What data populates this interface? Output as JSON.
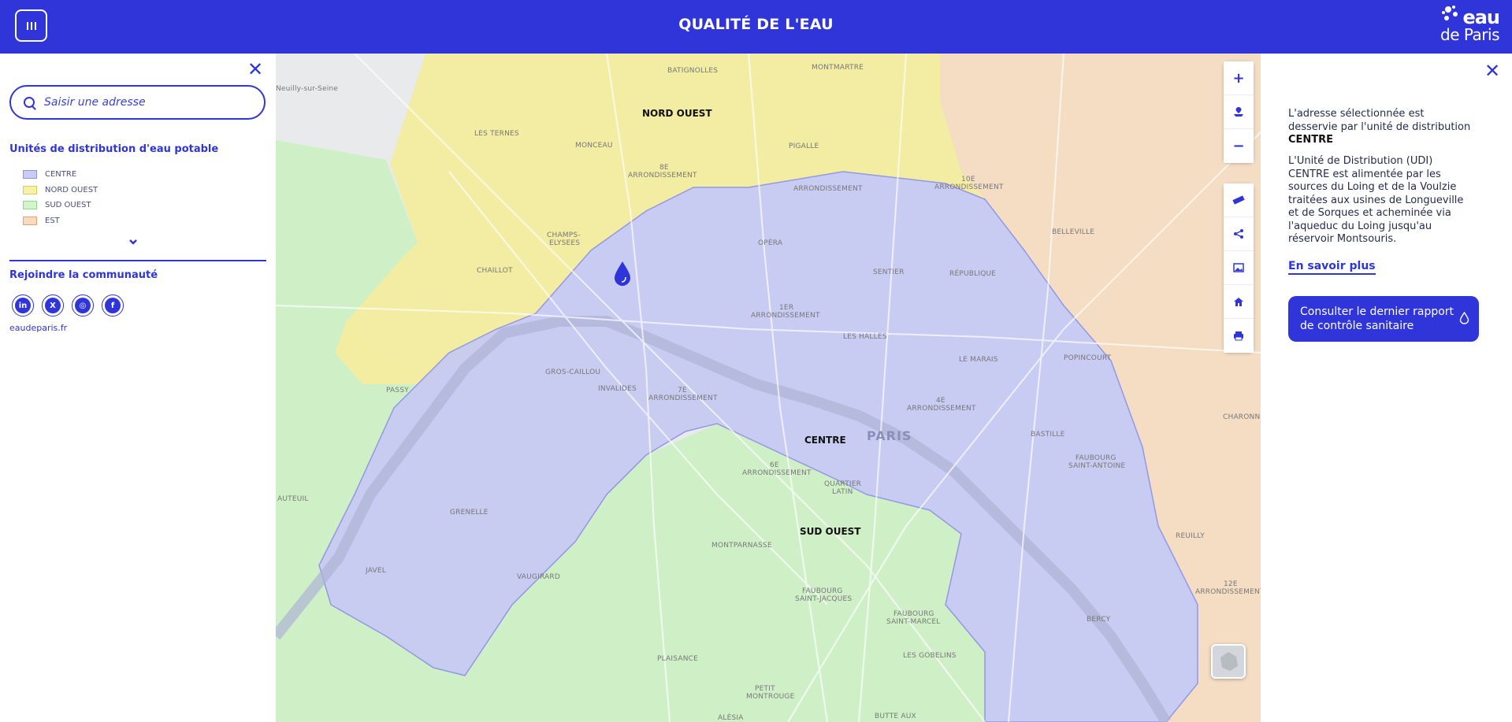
{
  "header": {
    "title": "QUALITÉ DE L'EAU",
    "brand_line1": "eau",
    "brand_line2": "de Paris"
  },
  "left_panel": {
    "search_placeholder": "Saisir une adresse",
    "legend_title": "Unités de distribution d'eau potable",
    "legend": [
      {
        "label": "CENTRE",
        "color": "#c9ccf5",
        "border": "#8d93e0"
      },
      {
        "label": "NORD OUEST",
        "color": "#f6f1a8",
        "border": "#d8cf5a"
      },
      {
        "label": "SUD OUEST",
        "color": "#d2f5cb",
        "border": "#98d58c"
      },
      {
        "label": "EST",
        "color": "#fbd9bd",
        "border": "#e6a46c"
      }
    ],
    "community_title": "Rejoindre la communauté",
    "socials": [
      {
        "name": "linkedin",
        "glyph": "in"
      },
      {
        "name": "x",
        "glyph": "X"
      },
      {
        "name": "instagram",
        "glyph": "◎"
      },
      {
        "name": "facebook",
        "glyph": "f"
      }
    ],
    "site_link": "eaudeparis.fr"
  },
  "map": {
    "zones": [
      {
        "name": "NORD OUEST",
        "color": "#f3ec9f"
      },
      {
        "name": "CENTRE",
        "color": "#c8cbf3"
      },
      {
        "name": "SUD OUEST",
        "color": "#cdf0c5"
      },
      {
        "name": "EST",
        "color": "#f6dcc2"
      }
    ],
    "zone_labels": {
      "nord_ouest": "NORD OUEST",
      "centre": "CENTRE",
      "sud_ouest": "SUD OUEST"
    },
    "city_label": "PARIS",
    "places": {
      "neuilly": "Neuilly-sur-Seine",
      "batignolles": "BATIGNOLLES",
      "montmartre": "MONTMARTRE",
      "les_ternes": "LES TERNES",
      "monceau": "MONCEAU",
      "pigalle": "PIGALLE",
      "arr8_a": "8E",
      "arr8_b": "ARRONDISSEMENT",
      "arr9": "ARRONDISSEMENT",
      "arr10_a": "10E",
      "arr10_b": "ARRONDISSEMENT",
      "champs": "CHAMPS-",
      "elysees": "ELYSEES",
      "opera": "OPÉRA",
      "chaillot": "CHAILLOT",
      "belleville": "BELLEVILLE",
      "sentier": "SENTIER",
      "republique": "RÉPUBLIQUE",
      "arr1_a": "1ER",
      "arr1_b": "ARRONDISSEMENT",
      "les_halles": "LES HALLES",
      "gros_caillou": "GROS-CAILLOU",
      "passy": "PASSY",
      "invalides": "INVALIDES",
      "arr7_a": "7E",
      "arr7_b": "ARRONDISSEMENT",
      "le_marais": "LE MARAIS",
      "popincourt": "POPINCOURT",
      "arr4_a": "4E",
      "arr4_b": "ARRONDISSEMENT",
      "bastille": "BASTILLE",
      "faubourg_sa_a": "FAUBOURG",
      "faubourg_sa_b": "SAINT-ANTOINE",
      "arr6_a": "6E",
      "arr6_b": "ARRONDISSEMENT",
      "quartier_a": "QUARTIER",
      "quartier_b": "LATIN",
      "auteuil": "AUTEUIL",
      "grenelle": "GRENELLE",
      "charonne": "CHARONNE",
      "montparnasse": "MONTPARNASSE",
      "reuilly": "REUILLY",
      "javel": "JAVEL",
      "vaugirard": "VAUGIRARD",
      "faubourg_sj_a": "FAUBOURG",
      "faubourg_sj_b": "SAINT-JACQUES",
      "faubourg_sm_a": "FAUBOURG",
      "faubourg_sm_b": "SAINT-MARCEL",
      "arr12_a": "12E",
      "arr12_b": "ARRONDISSEMENT",
      "bercy": "BERCY",
      "plaisance": "PLAISANCE",
      "les_gobelins": "LES GOBELINS",
      "petit_a": "PETIT",
      "petit_b": "MONTROUGE",
      "alesia": "ALÉSIA",
      "butte": "BUTTE AUX"
    }
  },
  "controls": {
    "zoom_in": "+",
    "zoom_out": "−"
  },
  "right_panel": {
    "intro": "L'adresse sélectionnée est desservie par l'unité de distribution",
    "udi_name": "CENTRE",
    "description": "L'Unité de Distribution (UDI) CENTRE est alimentée par les sources du Loing et de la Voulzie traitées aux usines de Longueville et de Sorques et acheminée via l'aqueduc du Loing jusqu'au réservoir Montsouris.",
    "more_link": "En savoir plus",
    "report_button": "Consulter le dernier rapport de contrôle sanitaire"
  }
}
